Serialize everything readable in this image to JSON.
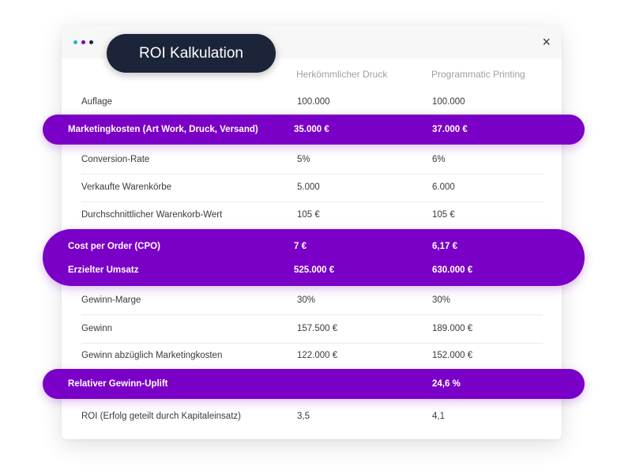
{
  "window": {
    "title": "ROI Kalkulation",
    "close_symbol": "×",
    "dot_colors": [
      "#1fb6c9",
      "#7b00c7",
      "#1b2438"
    ],
    "accent_color": "#7b00c7",
    "title_bg_color": "#1b2438"
  },
  "table": {
    "headers": [
      "",
      "Herkömmlicher Druck",
      "Programmatic Printing"
    ],
    "rows": [
      {
        "label": "Auflage",
        "a": "100.000",
        "b": "100.000"
      },
      {
        "label": "Marketingkosten (Art Work, Druck, Versand)",
        "a": "35.000 €",
        "b": "37.000 €"
      },
      {
        "label": "Conversion-Rate",
        "a": "5%",
        "b": "6%"
      },
      {
        "label": "Verkaufte Warenkörbe",
        "a": "5.000",
        "b": "6.000"
      },
      {
        "label": "Durchschnittlicher Warenkorb-Wert",
        "a": "105 €",
        "b": "105 €"
      },
      {
        "label": "Cost per Order (CPO)",
        "a": "7 €",
        "b": "6,17 €"
      },
      {
        "label": "Erzielter Umsatz",
        "a": "525.000 €",
        "b": "630.000 €"
      },
      {
        "label": "Gewinn-Marge",
        "a": "30%",
        "b": "30%"
      },
      {
        "label": "Gewinn",
        "a": "157.500 €",
        "b": "189.000 €"
      },
      {
        "label": "Gewinn abzüglich Marketingkosten",
        "a": "122.000 €",
        "b": "152.000 €"
      },
      {
        "label": "Relativer Gewinn-Uplift",
        "a": "",
        "b": "24,6 %"
      },
      {
        "label": "ROI (Erfolg geteilt durch Kapitaleinsatz)",
        "a": "3,5",
        "b": "4,1"
      }
    ]
  }
}
